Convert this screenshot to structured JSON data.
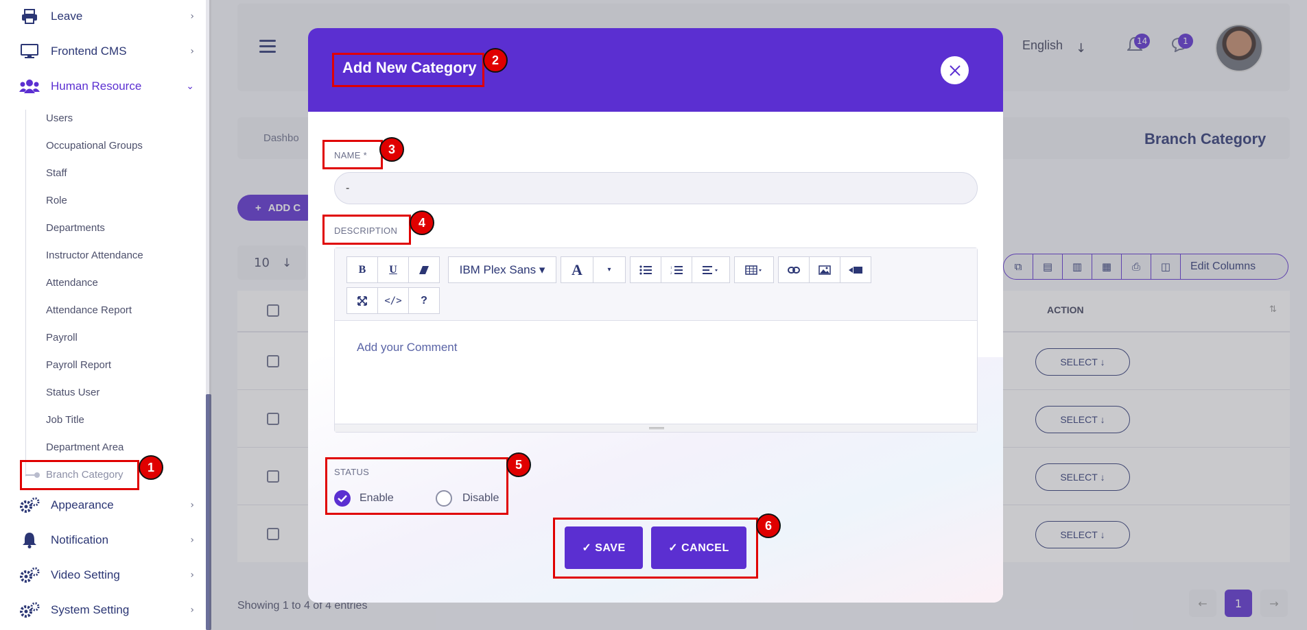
{
  "sidebar": {
    "top_items": [
      {
        "label": "Leave",
        "icon": "printer-icon"
      },
      {
        "label": "Frontend CMS",
        "icon": "monitor-icon"
      },
      {
        "label": "Human Resource",
        "icon": "users-icon"
      }
    ],
    "sub_items": [
      "Users",
      "Occupational Groups",
      "Staff",
      "Role",
      "Departments",
      "Instructor Attendance",
      "Attendance",
      "Attendance Report",
      "Payroll",
      "Payroll Report",
      "Status User",
      "Job Title",
      "Department Area",
      "Branch Category"
    ],
    "bottom_items": [
      {
        "label": "Appearance",
        "icon": "gears-icon"
      },
      {
        "label": "Notification",
        "icon": "bell-icon"
      },
      {
        "label": "Video Setting",
        "icon": "gears-icon"
      },
      {
        "label": "System Setting",
        "icon": "gears-icon"
      }
    ]
  },
  "header": {
    "language": "English",
    "notification_count": "14",
    "message_count": "1"
  },
  "breadcrumb": {
    "text": "Dashbo",
    "page_title": "Branch Category"
  },
  "toolbar": {
    "add_label": "ADD C",
    "per_page": "10",
    "edit_columns": "Edit Columns"
  },
  "table": {
    "action_header": "ACTION",
    "select_label": "SELECT",
    "showing_text": "Showing 1 to 4 of 4 entries",
    "current_page": "1"
  },
  "modal": {
    "title": "Add New Category",
    "name_label": "NAME *",
    "name_value": "-",
    "description_label": "DESCRIPTION",
    "font_name": "IBM Plex Sans",
    "editor_placeholder": "Add your Comment",
    "status_label": "STATUS",
    "enable_label": "Enable",
    "disable_label": "Disable",
    "status_value": "Enable",
    "save_label": "✓ SAVE",
    "cancel_label": "✓ CANCEL"
  },
  "annotations": [
    "1",
    "2",
    "3",
    "4",
    "5",
    "6"
  ],
  "colors": {
    "accent": "#5b2fd1",
    "annotation": "#e00000",
    "navy": "#2b3674"
  }
}
